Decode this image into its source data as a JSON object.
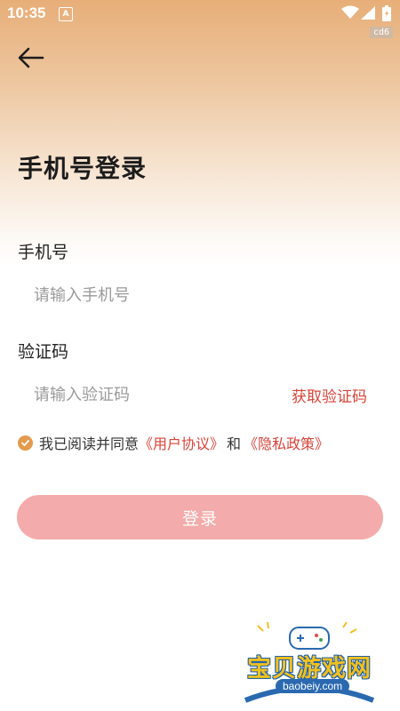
{
  "status_bar": {
    "time": "10:35",
    "notification_label": "A",
    "build_tag": "cd6"
  },
  "page": {
    "title": "手机号登录"
  },
  "phone": {
    "label": "手机号",
    "placeholder": "请输入手机号",
    "value": ""
  },
  "code": {
    "label": "验证码",
    "placeholder": "请输入验证码",
    "value": "",
    "get_code_label": "获取验证码"
  },
  "agreement": {
    "checked": true,
    "prefix": "我已阅读并同意",
    "user_agreement": "《用户协议》",
    "conjunction": "和",
    "privacy_policy": "《隐私政策》"
  },
  "login_button": {
    "label": "登录"
  },
  "watermark": {
    "text": "宝贝游戏网",
    "url": "baobeiy.com"
  },
  "colors": {
    "accent_red": "#d8443a",
    "button_pink": "#f4abab",
    "check_orange": "#e49a4d",
    "header_gradient_top": "#e7ae78"
  },
  "icons": [
    "back-arrow-icon",
    "wifi-icon",
    "signal-icon",
    "battery-icon",
    "checkmark-icon"
  ]
}
